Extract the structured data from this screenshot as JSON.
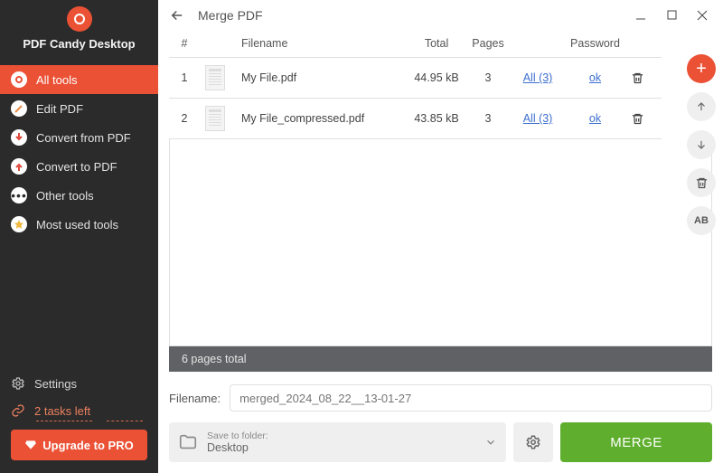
{
  "app": {
    "title": "PDF Candy Desktop"
  },
  "sidebar": {
    "items": [
      {
        "label": "All tools"
      },
      {
        "label": "Edit PDF"
      },
      {
        "label": "Convert from PDF"
      },
      {
        "label": "Convert to PDF"
      },
      {
        "label": "Other tools"
      },
      {
        "label": "Most used tools"
      }
    ],
    "settings_label": "Settings",
    "tasks_label": "2 tasks left",
    "upgrade_label": "Upgrade to PRO"
  },
  "header": {
    "title": "Merge PDF"
  },
  "table": {
    "headers": {
      "num": "#",
      "filename": "Filename",
      "total": "Total",
      "pages": "Pages",
      "password": "Password"
    },
    "rows": [
      {
        "num": "1",
        "filename": "My File.pdf",
        "total": "44.95 kB",
        "pages": "3",
        "pages_link": "All (3)",
        "password": "ok"
      },
      {
        "num": "2",
        "filename": "My File_compressed.pdf",
        "total": "43.85 kB",
        "pages": "3",
        "pages_link": "All (3)",
        "password": "ok"
      }
    ]
  },
  "status": {
    "text": "6 pages total"
  },
  "output": {
    "filename_label": "Filename:",
    "filename_placeholder": "merged_2024_08_22__13-01-27",
    "save_label": "Save to folder:",
    "save_value": "Desktop",
    "merge_label": "MERGE"
  },
  "rail": {
    "ab": "AB"
  }
}
